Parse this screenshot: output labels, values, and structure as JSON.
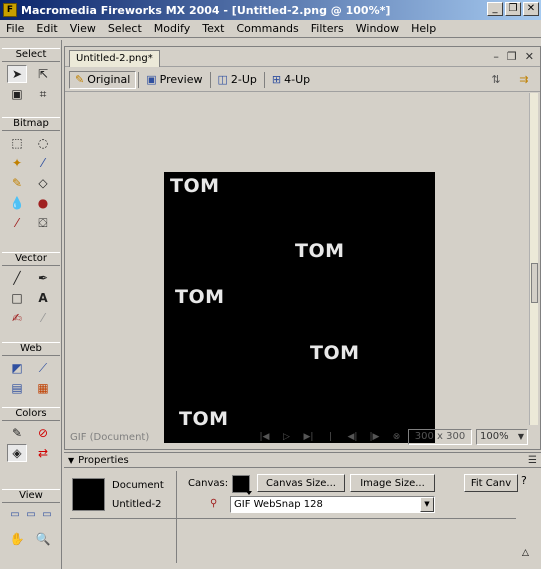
{
  "window": {
    "title": "Macromedia Fireworks MX 2004 - [Untitled-2.png @ 100%*]",
    "minimize": "_",
    "restore": "❐",
    "close": "✕"
  },
  "menu": [
    "File",
    "Edit",
    "View",
    "Select",
    "Modify",
    "Text",
    "Commands",
    "Filters",
    "Window",
    "Help"
  ],
  "tools": {
    "sections": [
      "Select",
      "Bitmap",
      "Vector",
      "Web",
      "Colors",
      "View"
    ]
  },
  "document": {
    "tab": "Untitled-2.png*",
    "views": [
      "Original",
      "Preview",
      "2-Up",
      "4-Up"
    ],
    "canvas_text": [
      "TOM",
      "TOM",
      "TOM",
      "TOM",
      "TOM"
    ],
    "status_format": "GIF (Document)",
    "dimensions": "300 x 300",
    "zoom": "100%"
  },
  "properties": {
    "title": "Properties",
    "doc_label": "Document",
    "doc_name": "Untitled-2",
    "canvas_label": "Canvas:",
    "canvas_size_button": "Canvas Size...",
    "image_size_button": "Image Size...",
    "fit_canvas_button": "Fit Canv",
    "export_setting": "GIF WebSnap 128",
    "canvas_color": "#000000"
  }
}
